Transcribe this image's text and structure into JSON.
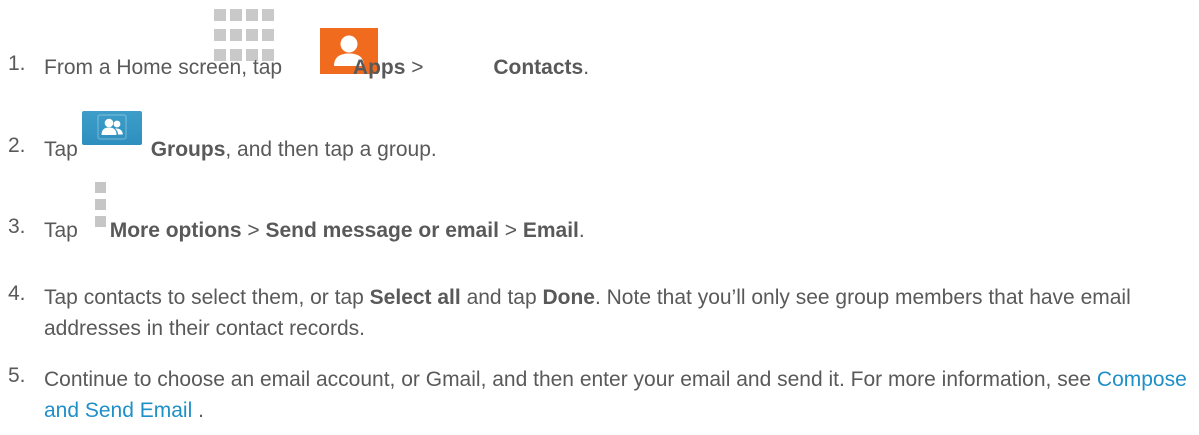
{
  "steps": [
    {
      "num": "1.",
      "pre": "From a Home screen, tap ",
      "apps": "Apps",
      "sep": " > ",
      "contacts": "Contacts",
      "end": "."
    },
    {
      "num": "2.",
      "pre": "Tap ",
      "groups": "Groups",
      "post": ", and then tap a group."
    },
    {
      "num": "3.",
      "pre": "Tap ",
      "more": "More options",
      "sep1": " > ",
      "send": "Send message or email",
      "sep2": " > ",
      "email": "Email",
      "end": "."
    },
    {
      "num": "4.",
      "pre": "Tap contacts to select them, or tap ",
      "select_all": "Select all",
      "mid": " and tap ",
      "done": "Done",
      "post": ". Note that you’ll only see group members that have email addresses in their contact records."
    },
    {
      "num": "5.",
      "pre": "Continue to choose an email account, or Gmail, and then enter your email and send it. For more information, see ",
      "link": "Compose and Send Email",
      "end": " ."
    }
  ],
  "icons": {
    "apps": "apps-grid-icon",
    "contacts": "contacts-icon",
    "groups": "groups-icon",
    "more": "more-options-icon"
  },
  "colors": {
    "text": "#595959",
    "link": "#1f8fc7",
    "contacts_icon": "#f06b1e",
    "groups_icon": "#2e8fbf",
    "apps_icon": "#c9c9c9"
  }
}
